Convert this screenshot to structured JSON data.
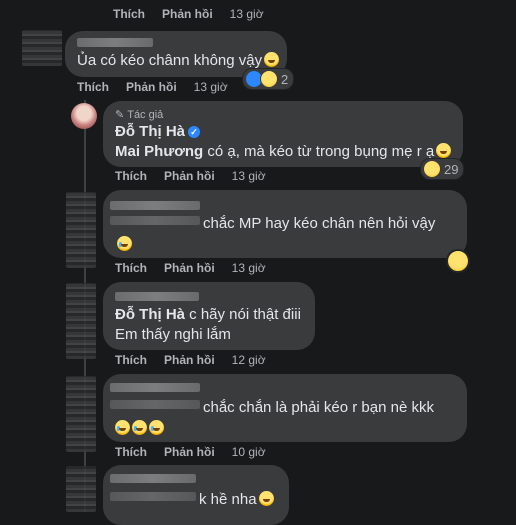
{
  "labels": {
    "like": "Thích",
    "reply": "Phản hồi",
    "author_badge": "Tác giả"
  },
  "comments": [
    {
      "time": "13 giờ"
    },
    {
      "text": "Ủa có kéo chânn không vậy",
      "reaction_count": "2",
      "time": "13 giờ"
    },
    {
      "author": "Đỗ Thị Hà",
      "mention": "Mai Phương",
      "text": " có ạ, mà kéo từ trong bụng mẹ r ạ",
      "reaction_count": "29",
      "time": "13 giờ"
    },
    {
      "text_line1": "chắc MP hay kéo chân nên hỏi vậy",
      "time": "13 giờ"
    },
    {
      "mention": "Đỗ Thị Hà",
      "text_line1": " c hãy nói thật điii",
      "text_line2": "Em thấy nghi lắm",
      "time": "12 giờ"
    },
    {
      "text_line1": "chắc chắn là phải kéo r bạn nè kkk",
      "time": "10 giờ"
    },
    {
      "text_line1": "k hề nha"
    }
  ],
  "colors": {
    "background": "#18191a",
    "bubble": "#3a3b3c",
    "verified": "#2d88ff"
  }
}
